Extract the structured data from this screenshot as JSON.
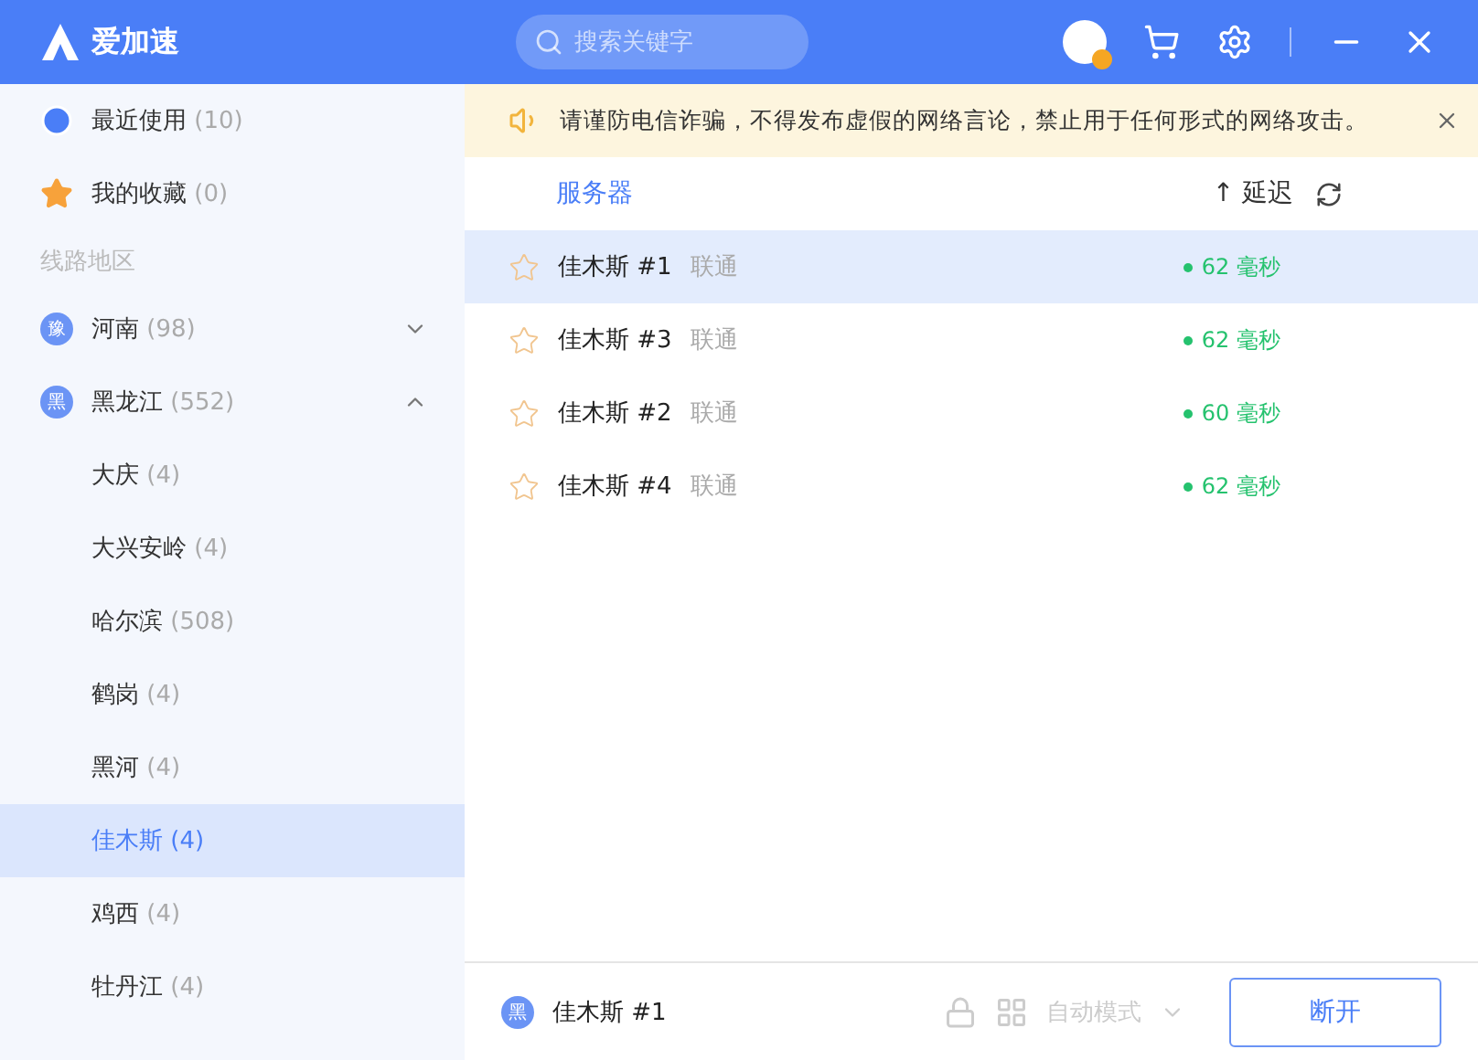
{
  "app": {
    "name": "爱加速"
  },
  "search": {
    "placeholder": "搜索关键字"
  },
  "sidebar": {
    "top_items": [
      {
        "kind": "recent",
        "label": "最近使用",
        "count": "(10)"
      },
      {
        "kind": "favorites",
        "label": "我的收藏",
        "count": "(0)"
      }
    ],
    "section_label": "线路地区",
    "regions": [
      {
        "badge": "豫",
        "label": "河南",
        "count": "(98)",
        "expanded": false
      },
      {
        "badge": "黑",
        "label": "黑龙江",
        "count": "(552)",
        "expanded": true,
        "children": [
          {
            "label": "大庆",
            "count": "(4)",
            "selected": false
          },
          {
            "label": "大兴安岭",
            "count": "(4)",
            "selected": false
          },
          {
            "label": "哈尔滨",
            "count": "(508)",
            "selected": false
          },
          {
            "label": "鹤岗",
            "count": "(4)",
            "selected": false
          },
          {
            "label": "黑河",
            "count": "(4)",
            "selected": false
          },
          {
            "label": "佳木斯",
            "count": "(4)",
            "selected": true
          },
          {
            "label": "鸡西",
            "count": "(4)",
            "selected": false
          },
          {
            "label": "牡丹江",
            "count": "(4)",
            "selected": false
          }
        ]
      }
    ]
  },
  "notice": {
    "text": "请谨防电信诈骗，不得发布虚假的网络言论，禁止用于任何形式的网络攻击。"
  },
  "table": {
    "columns": [
      "服务器",
      "↑ 延迟"
    ],
    "rows": [
      {
        "name": "佳木斯 #1",
        "isp": "联通",
        "latency": "62 毫秒",
        "favorite": false,
        "selected": true
      },
      {
        "name": "佳木斯 #3",
        "isp": "联通",
        "latency": "62 毫秒",
        "favorite": false,
        "selected": false
      },
      {
        "name": "佳木斯 #2",
        "isp": "联通",
        "latency": "60 毫秒",
        "favorite": false,
        "selected": false
      },
      {
        "name": "佳木斯 #4",
        "isp": "联通",
        "latency": "62 毫秒",
        "favorite": false,
        "selected": false
      }
    ]
  },
  "footer": {
    "badge": "黑",
    "server": "佳木斯 #1",
    "mode": "自动模式",
    "mode_disabled": true,
    "button": "断开"
  }
}
